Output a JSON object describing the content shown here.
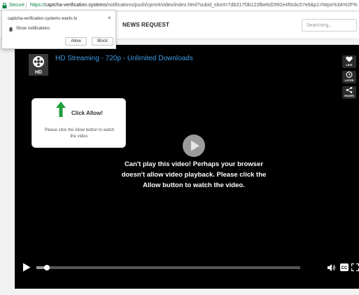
{
  "address_bar": {
    "secure_label": "Secure",
    "url_scheme": "https://",
    "url_host": "captcha-verification.systems",
    "url_path": "/notifications/push/cpm/4/video/index.html?subid_short=7db317f3b123fbe6d2992e4f0cbc57e6&p1=https%3A%2F%"
  },
  "site_header": {
    "nav_items": [
      "NEWS",
      "REQUEST"
    ],
    "search_placeholder": "Searching..."
  },
  "notification_popup": {
    "title": "captcha-verification.systems wants to",
    "permission": "Show notifications",
    "allow_label": "Allow",
    "block_label": "Block",
    "close_glyph": "×"
  },
  "player": {
    "title": "HD Streaming - 720p - Unlimited Downloads",
    "logo_icon": "film-reel-hd-icon",
    "side_buttons": [
      {
        "label": "LIKE",
        "icon": "heart-icon"
      },
      {
        "label": "LATER",
        "icon": "clock-icon"
      },
      {
        "label": "SHARE",
        "icon": "share-icon"
      }
    ],
    "click_card": {
      "title": "Click Allow!",
      "description": "Please click the Allow button to watch the video."
    },
    "message": "Can't play this video! Perhaps your browser doesn't allow video playback. Please click the Allow button to watch the video.",
    "progress": 0.035,
    "colors": {
      "title": "#3f9be4",
      "arrow": "#1e9e3c",
      "secure": "#0b8043"
    }
  }
}
